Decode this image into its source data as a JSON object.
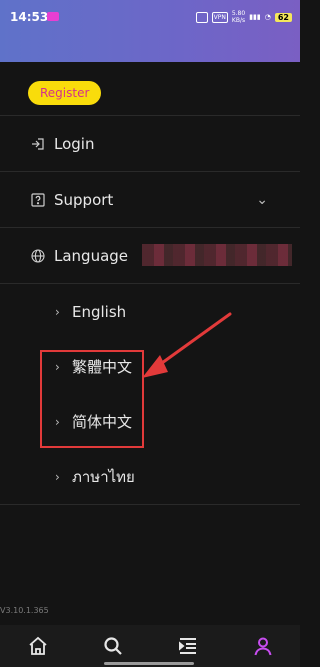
{
  "status_bar": {
    "time": "14:53",
    "vpn": "VPN",
    "speed_value": "5.80",
    "speed_unit": "KB/s",
    "battery": "62"
  },
  "menu": {
    "register_label": "Register",
    "items": [
      {
        "label": "Login",
        "icon": "login-icon"
      },
      {
        "label": "Support",
        "icon": "help-icon"
      },
      {
        "label": "Language",
        "icon": "globe-icon"
      }
    ],
    "languages": [
      {
        "label": "English"
      },
      {
        "label": "繁體中文"
      },
      {
        "label": "简体中文"
      },
      {
        "label": "ภาษาไทย"
      }
    ]
  },
  "version": "V3.10.1.365",
  "tabbar": {
    "items": [
      "home-icon",
      "search-icon",
      "menu-list-icon",
      "profile-icon"
    ],
    "active_color": "#c84df0"
  },
  "colors": {
    "header_start": "#5f72c9",
    "register_bg": "#f9dc0b",
    "register_text": "#d4328a",
    "annotation": "#e23a3a"
  }
}
